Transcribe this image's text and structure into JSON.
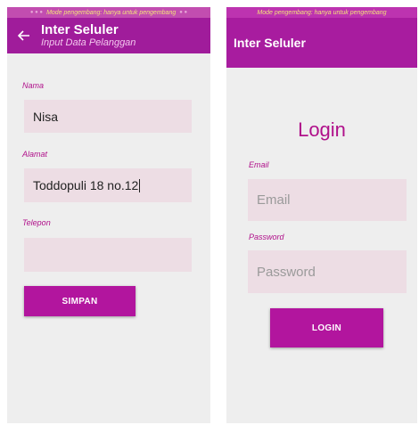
{
  "left": {
    "status_text": "Mode pengembang: hanya untuk pengembang",
    "title": "Inter Seluler",
    "subtitle": "Input Data Pelanggan",
    "fields": [
      {
        "label": "Nama",
        "value": "Nisa",
        "placeholder": ""
      },
      {
        "label": "Alamat",
        "value": "Toddopuli 18 no.12",
        "placeholder": ""
      },
      {
        "label": "Telepon",
        "value": "",
        "placeholder": ""
      }
    ],
    "button_label": "SIMPAN"
  },
  "right": {
    "status_text": "Mode pengembang: hanya untuk pengembang",
    "title": "Inter Seluler",
    "heading": "Login",
    "email_label": "Email",
    "email_placeholder": "Email",
    "password_label": "Password",
    "password_placeholder": "Password",
    "button_label": "LOGIN"
  },
  "colors": {
    "primary": "#a01c9b",
    "accent_text": "#b0108a",
    "field_bg": "#eddde4",
    "background": "#eeeeee"
  }
}
